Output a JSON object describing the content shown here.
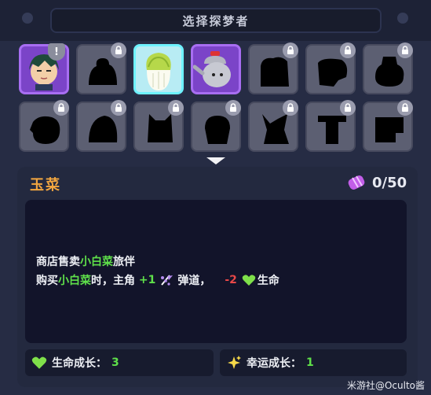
{
  "header": {
    "title": "选择探梦者"
  },
  "roster": [
    {
      "id": "dreamer-1",
      "state": "unlocked",
      "frame": "purple",
      "badge": "!"
    },
    {
      "id": "slot-2",
      "state": "locked"
    },
    {
      "id": "yucai",
      "state": "selected",
      "frame": "cyan"
    },
    {
      "id": "kettle",
      "state": "unlocked",
      "frame": "purple"
    },
    {
      "id": "slot-5",
      "state": "locked"
    },
    {
      "id": "slot-6",
      "state": "locked"
    },
    {
      "id": "slot-7",
      "state": "locked"
    },
    {
      "id": "slot-8",
      "state": "locked"
    },
    {
      "id": "slot-9",
      "state": "locked"
    },
    {
      "id": "slot-10",
      "state": "locked"
    },
    {
      "id": "slot-11",
      "state": "locked"
    },
    {
      "id": "slot-12",
      "state": "locked"
    },
    {
      "id": "slot-13",
      "state": "locked"
    },
    {
      "id": "slot-14",
      "state": "locked"
    }
  ],
  "detail": {
    "name": "玉菜",
    "progress": "0/50",
    "desc": {
      "line1": {
        "pre": "商店售卖",
        "hl": "小白菜",
        "post": "旅伴"
      },
      "line2": {
        "pre": "购买",
        "hl": "小白菜",
        "mid": "时，主角 ",
        "bonus": "+1",
        "bonus_label": "弹道，",
        "penalty": "-2",
        "penalty_label": "生命"
      }
    },
    "stats": [
      {
        "label": "生命成长：",
        "value": "3",
        "icon": "green-heart-icon"
      },
      {
        "label": "幸运成长：",
        "value": "1",
        "icon": "sparkle-icon"
      }
    ]
  },
  "watermark": "米游社@Oculto酱",
  "colors": {
    "accent_orange": "#f2a640",
    "highlight_green": "#5fe04a",
    "penalty_red": "#e84848",
    "rare_purple": "#7b44c8",
    "selected_cyan": "#6ef2ff"
  }
}
